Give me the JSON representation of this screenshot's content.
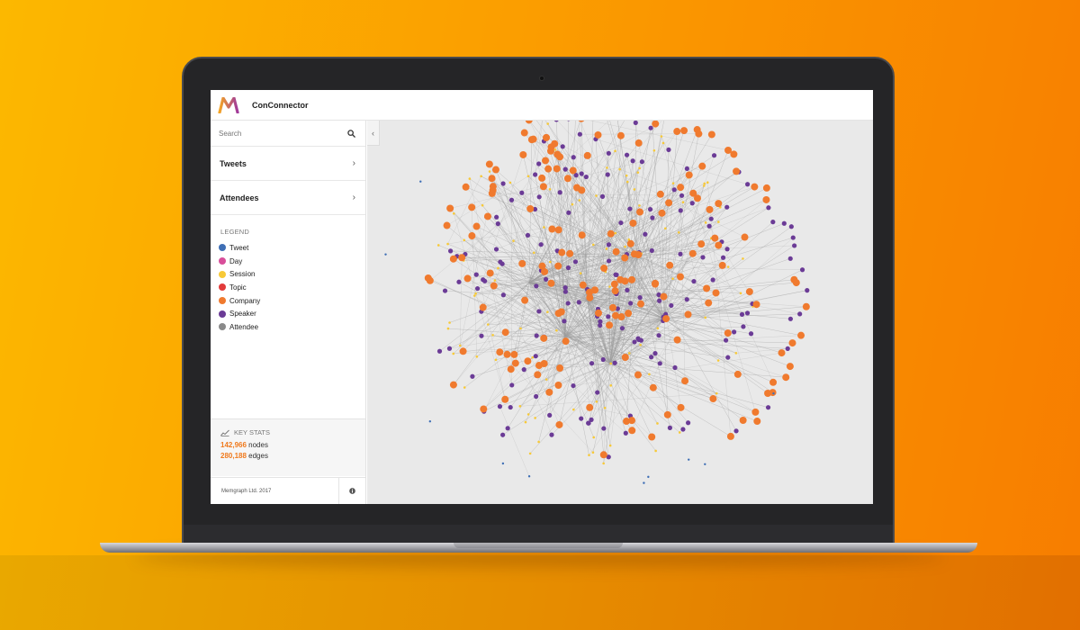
{
  "app": {
    "title": "ConConnector",
    "logo_colors": [
      "#f5a524",
      "#a0389c"
    ]
  },
  "search": {
    "placeholder": "Search"
  },
  "nav": [
    {
      "label": "Tweets"
    },
    {
      "label": "Attendees"
    }
  ],
  "legend": {
    "title": "LEGEND",
    "items": [
      {
        "label": "Tweet",
        "color": "#3f6fb5"
      },
      {
        "label": "Day",
        "color": "#d84e9a"
      },
      {
        "label": "Session",
        "color": "#f7c937"
      },
      {
        "label": "Topic",
        "color": "#e23b3b"
      },
      {
        "label": "Company",
        "color": "#f07a2e"
      },
      {
        "label": "Speaker",
        "color": "#6b3b96"
      },
      {
        "label": "Attendee",
        "color": "#8a8a8a"
      }
    ]
  },
  "stats": {
    "title": "KEY STATS",
    "nodes_value": "142,966",
    "nodes_label": "nodes",
    "edges_value": "280,188",
    "edges_label": "edges"
  },
  "footer": {
    "copyright": "Memgraph Ltd. 2017"
  },
  "graph": {
    "edge_color": "#9d9d9d",
    "background": "#e9e9e9",
    "node_types": [
      "Company",
      "Speaker",
      "Session",
      "Tweet"
    ]
  }
}
